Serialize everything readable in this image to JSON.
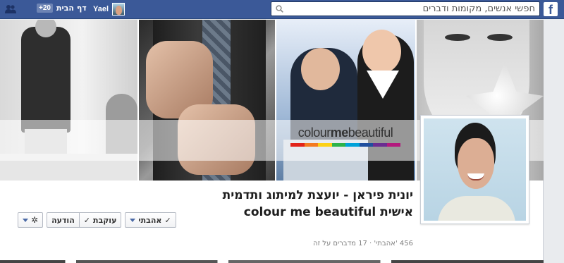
{
  "topbar": {
    "logo_letter": "f",
    "search_placeholder": "חפשי אנשים, מקומות ודברים",
    "user_name": "Yael",
    "home_label": "דף הבית",
    "home_badge": "+20"
  },
  "cover": {
    "brand_light_1": "colour",
    "brand_bold": "me",
    "brand_light_2": "beautiful",
    "rainbow_colors": [
      "#e2231a",
      "#f47b20",
      "#fcd116",
      "#2db34a",
      "#00a2d9",
      "#1f4e9e",
      "#6a2c91",
      "#b3197d"
    ]
  },
  "page": {
    "title": "יונית פיראן - יועצת למיתוג ותדמית אישית colour me beautiful",
    "meta": "456 'אהבתי' · 17 מדברים על זה"
  },
  "actions": {
    "liked_label": "אהבתי",
    "following_label": "עוקבת",
    "message_label": "הודעה",
    "check_glyph": "✓",
    "gear_glyph": "✲"
  },
  "colors": {
    "topbar": "#3b5998",
    "accent": "#4b6aa6"
  }
}
